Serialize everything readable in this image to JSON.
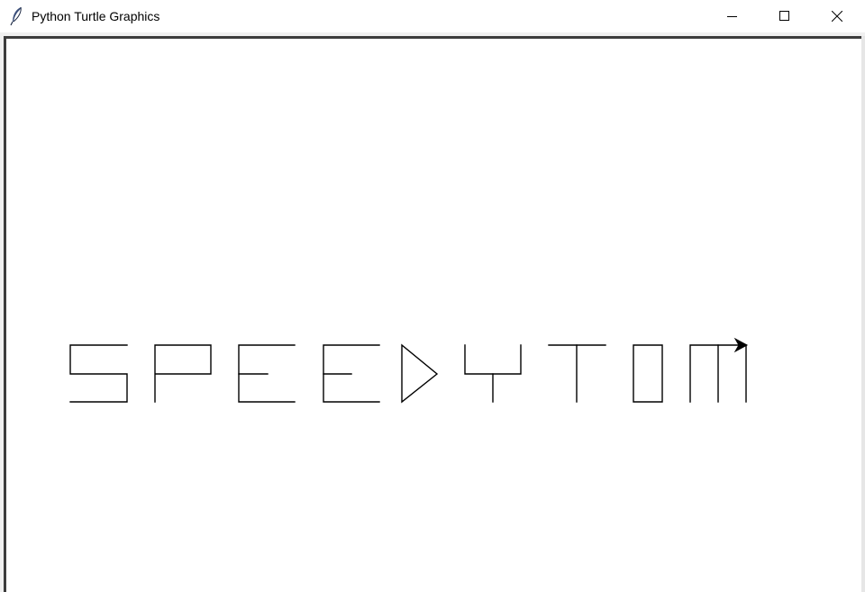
{
  "window": {
    "title": "Python Turtle Graphics",
    "app_icon": "feather-icon",
    "controls": {
      "minimize_icon": "minimize-icon",
      "maximize_icon": "maximize-icon",
      "close_icon": "close-icon"
    }
  },
  "canvas": {
    "background": "#ffffff",
    "pen_color": "#000000",
    "drawn_text": "SPEEDYTOM",
    "turtle_shape": "arrow",
    "turtle_heading": "east"
  }
}
